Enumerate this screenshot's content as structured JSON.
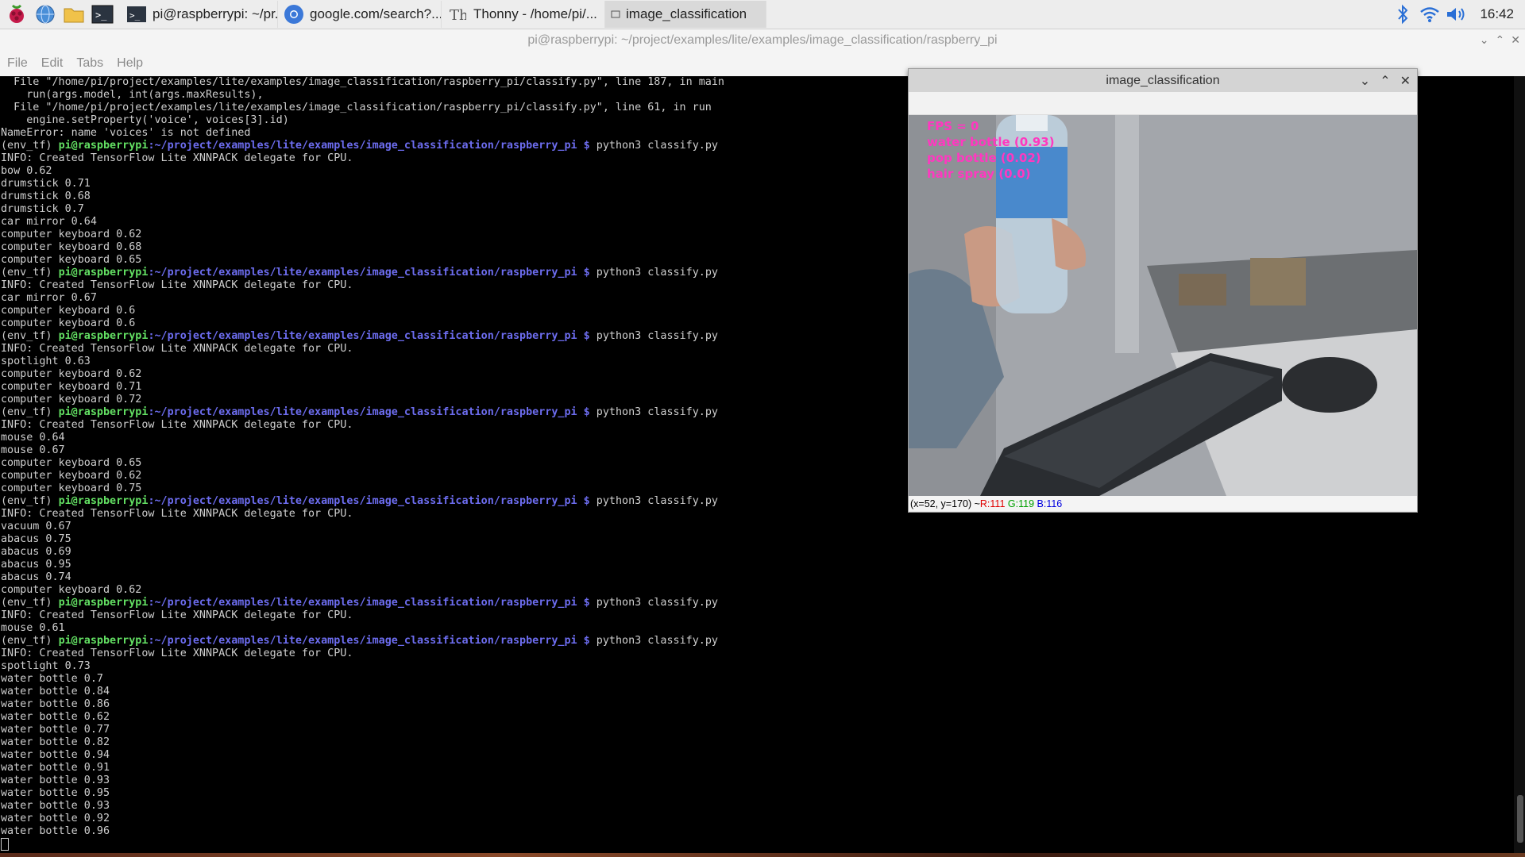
{
  "taskbar": {
    "tasks": [
      {
        "label": "pi@raspberrypi: ~/pr...",
        "active": false
      },
      {
        "label": "google.com/search?...",
        "active": false
      },
      {
        "label": "Thonny  -  /home/pi/...",
        "active": false
      },
      {
        "label": "image_classification",
        "active": true
      }
    ],
    "clock": "16:42"
  },
  "terminal": {
    "title": "pi@raspberrypi: ~/project/examples/lite/examples/image_classification/raspberry_pi",
    "menu": [
      "File",
      "Edit",
      "Tabs",
      "Help"
    ],
    "prompt_env": "(env_tf) ",
    "prompt_user": "pi@raspberrypi",
    "prompt_path": ":~/project/examples/lite/examples/image_classification/raspberry_pi $",
    "command": " python3 classify.py",
    "lines": [
      {
        "t": "  File \"/home/pi/project/examples/lite/examples/image_classification/raspberry_pi/classify.py\", line 187, in main"
      },
      {
        "t": "    run(args.model, int(args.maxResults),"
      },
      {
        "t": "  File \"/home/pi/project/examples/lite/examples/image_classification/raspberry_pi/classify.py\", line 61, in run"
      },
      {
        "t": "    engine.setProperty('voice', voices[3].id)"
      },
      {
        "t": "NameError: name 'voices' is not defined"
      },
      {
        "p": true
      },
      {
        "t": "INFO: Created TensorFlow Lite XNNPACK delegate for CPU."
      },
      {
        "t": "bow 0.62"
      },
      {
        "t": "drumstick 0.71"
      },
      {
        "t": "drumstick 0.68"
      },
      {
        "t": "drumstick 0.7"
      },
      {
        "t": "car mirror 0.64"
      },
      {
        "t": "computer keyboard 0.62"
      },
      {
        "t": "computer keyboard 0.68"
      },
      {
        "t": "computer keyboard 0.65"
      },
      {
        "p": true
      },
      {
        "t": "INFO: Created TensorFlow Lite XNNPACK delegate for CPU."
      },
      {
        "t": "car mirror 0.67"
      },
      {
        "t": "computer keyboard 0.6"
      },
      {
        "t": "computer keyboard 0.6"
      },
      {
        "p": true
      },
      {
        "t": "INFO: Created TensorFlow Lite XNNPACK delegate for CPU."
      },
      {
        "t": "spotlight 0.63"
      },
      {
        "t": "computer keyboard 0.62"
      },
      {
        "t": "computer keyboard 0.71"
      },
      {
        "t": "computer keyboard 0.72"
      },
      {
        "p": true
      },
      {
        "t": "INFO: Created TensorFlow Lite XNNPACK delegate for CPU."
      },
      {
        "t": "mouse 0.64"
      },
      {
        "t": "mouse 0.67"
      },
      {
        "t": "computer keyboard 0.65"
      },
      {
        "t": "computer keyboard 0.62"
      },
      {
        "t": "computer keyboard 0.75"
      },
      {
        "p": true
      },
      {
        "t": "INFO: Created TensorFlow Lite XNNPACK delegate for CPU."
      },
      {
        "t": "vacuum 0.67"
      },
      {
        "t": "abacus 0.75"
      },
      {
        "t": "abacus 0.69"
      },
      {
        "t": "abacus 0.95"
      },
      {
        "t": "abacus 0.74"
      },
      {
        "t": "computer keyboard 0.62"
      },
      {
        "p": true
      },
      {
        "t": "INFO: Created TensorFlow Lite XNNPACK delegate for CPU."
      },
      {
        "t": "mouse 0.61"
      },
      {
        "p": true
      },
      {
        "t": "INFO: Created TensorFlow Lite XNNPACK delegate for CPU."
      },
      {
        "t": "spotlight 0.73"
      },
      {
        "t": "water bottle 0.7"
      },
      {
        "t": "water bottle 0.84"
      },
      {
        "t": "water bottle 0.86"
      },
      {
        "t": "water bottle 0.62"
      },
      {
        "t": "water bottle 0.77"
      },
      {
        "t": "water bottle 0.82"
      },
      {
        "t": "water bottle 0.94"
      },
      {
        "t": "water bottle 0.91"
      },
      {
        "t": "water bottle 0.93"
      },
      {
        "t": "water bottle 0.95"
      },
      {
        "t": "water bottle 0.93"
      },
      {
        "t": "water bottle 0.92"
      },
      {
        "t": "water bottle 0.96"
      }
    ]
  },
  "image_window": {
    "title": "image_classification",
    "overlay": [
      "FPS = 0",
      "water bottle (0.93)",
      "pop bottle (0.02)",
      "hair spray (0.0)"
    ],
    "status": {
      "coords": "(x=52, y=170) ~ ",
      "r": "R:111",
      "g": "G:119",
      "b": "B:116"
    },
    "colors": {
      "overlay": "#ff38c0",
      "r": "#e00000",
      "g": "#00a000",
      "b": "#0000e0"
    }
  }
}
